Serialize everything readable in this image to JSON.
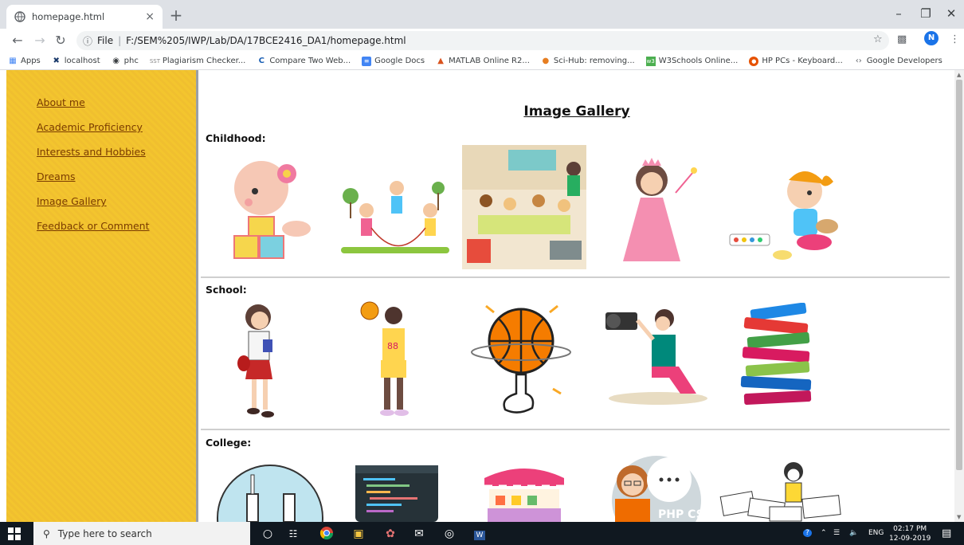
{
  "browser": {
    "tab_title": "homepage.html",
    "tab_close": "×",
    "new_tab": "+",
    "url_prefix": "File",
    "url": "F:/SEM%205/IWP/Lab/DA/17BCE2416_DA1/homepage.html",
    "profile_initial": "N",
    "bookmarks": [
      {
        "label": "Apps",
        "icon": "apps-grid-icon"
      },
      {
        "label": "localhost",
        "icon": "tools-icon"
      },
      {
        "label": "phc",
        "icon": "globe-icon"
      },
      {
        "label": "Plagiarism Checker...",
        "icon": "plagiarism-icon"
      },
      {
        "label": "Compare Two Web...",
        "icon": "compare-icon"
      },
      {
        "label": "Google Docs",
        "icon": "docs-icon"
      },
      {
        "label": "MATLAB Online R2...",
        "icon": "matlab-icon"
      },
      {
        "label": "Sci-Hub: removing...",
        "icon": "scihub-icon"
      },
      {
        "label": "W3Schools Online...",
        "icon": "w3schools-icon"
      },
      {
        "label": "HP PCs - Keyboard...",
        "icon": "hp-icon"
      },
      {
        "label": "Google Developers",
        "icon": "developers-icon"
      }
    ]
  },
  "sidebar": {
    "items": [
      {
        "label": "About me"
      },
      {
        "label": "Academic Proficiency"
      },
      {
        "label": "Interests and Hobbies"
      },
      {
        "label": "Dreams"
      },
      {
        "label": "Image Gallery"
      },
      {
        "label": "Feedback or Comment"
      }
    ]
  },
  "main": {
    "title": "Image Gallery",
    "sections": [
      {
        "label": "Childhood:"
      },
      {
        "label": "School:"
      },
      {
        "label": "College:"
      }
    ]
  },
  "taskbar": {
    "search_placeholder": "Type here to search",
    "language": "ENG",
    "time": "02:17 PM",
    "date": "12-09-2019"
  },
  "colors": {
    "sidebar": "#f2c12e",
    "link": "#7a3b00",
    "taskbar": "#101820"
  }
}
